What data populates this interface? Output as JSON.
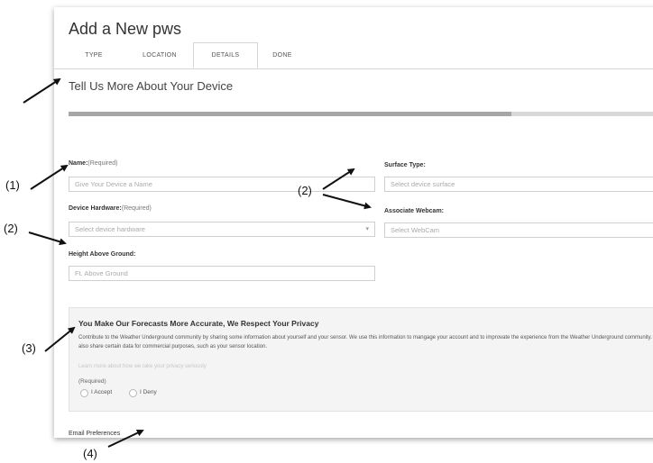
{
  "header": {
    "title": "Add a New pws"
  },
  "tabs": [
    {
      "label": "TYPE"
    },
    {
      "label": "LOCATION"
    },
    {
      "label": "DETAILS",
      "active": true
    },
    {
      "label": "DONE"
    }
  ],
  "section": {
    "title": "Tell Us More About Your Device"
  },
  "progress": {
    "fraction": 0.74
  },
  "form": {
    "name": {
      "label": "Name:",
      "required": "(Required)",
      "placeholder": "Give Your Device a Name"
    },
    "hardware": {
      "label": "Device Hardware:",
      "required": "(Required)",
      "placeholder": "Select device hardware"
    },
    "height": {
      "label": "Height Above Ground:",
      "placeholder": "Ft. Above Ground"
    },
    "surface": {
      "label": "Surface Type:",
      "placeholder": "Select device surface"
    },
    "webcam": {
      "label": "Associate Webcam:",
      "placeholder": "Select WebCam"
    }
  },
  "privacy": {
    "title": "You Make Our Forecasts More Accurate, We Respect Your Privacy",
    "body": "Contribute to the Weather Underground community by sharing some information about yourself and your sensor. We use this information to mangage your account and to improvate the experience from the Weather Underground community. We may also share certain data for commercial purposes, such as your sensor location.",
    "link": "Learn more about how we take your privacy seriously",
    "required": "(Required)",
    "accept": "I Accept",
    "deny": "I Deny"
  },
  "email": {
    "label": "Email Preferences"
  },
  "annotations": {
    "a1": "(1)",
    "a2_left": "(2)",
    "a2_mid": "(2)",
    "a3": "(3)",
    "a4": "(4)"
  }
}
